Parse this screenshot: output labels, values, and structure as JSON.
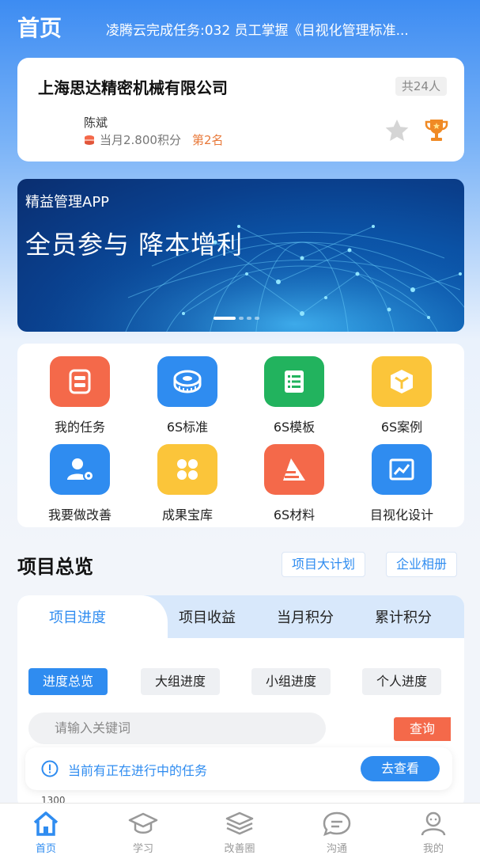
{
  "header": {
    "title": "首页",
    "ticker": "凌腾云完成任务:032 员工掌握《目视化管理标准..."
  },
  "company": {
    "name": "上海思达精密机械有限公司",
    "member_count": "共24人",
    "user_name": "陈斌",
    "points": "当月2.800积分",
    "rank": "第2名"
  },
  "banner": {
    "subtitle": "精益管理APP",
    "headline": "全员参与  降本增利",
    "slide_count": 4,
    "active_slide": 1
  },
  "grid": {
    "items": [
      {
        "label": "我的任务",
        "icon": "task-icon",
        "color": "#f4694a"
      },
      {
        "label": "6S标准",
        "icon": "tape-measure-icon",
        "color": "#2f8cf0"
      },
      {
        "label": "6S模板",
        "icon": "list-icon",
        "color": "#22b35e"
      },
      {
        "label": "6S案例",
        "icon": "cube-icon",
        "color": "#fbc53a"
      },
      {
        "label": "我要做改善",
        "icon": "user-gear-icon",
        "color": "#2f8cf0"
      },
      {
        "label": "成果宝库",
        "icon": "apps-icon",
        "color": "#fbc53a"
      },
      {
        "label": "6S材料",
        "icon": "material-icon",
        "color": "#f4694a"
      },
      {
        "label": "目视化设计",
        "icon": "chart-icon",
        "color": "#2f8cf0"
      }
    ]
  },
  "overview": {
    "title": "项目总览",
    "plan_button": "项目大计划",
    "album_button": "企业相册",
    "tabs": [
      "项目进度",
      "项目收益",
      "当月积分",
      "累计积分"
    ],
    "subtabs": [
      "进度总览",
      "大组进度",
      "小组进度",
      "个人进度"
    ],
    "search_placeholder": "请输入关键词",
    "query_button": "查询",
    "notice_text": "当前有正在进行中的任务",
    "notice_button": "去查看",
    "axis_value": "1300"
  },
  "nav": {
    "items": [
      "首页",
      "学习",
      "改善圈",
      "沟通",
      "我的"
    ]
  }
}
